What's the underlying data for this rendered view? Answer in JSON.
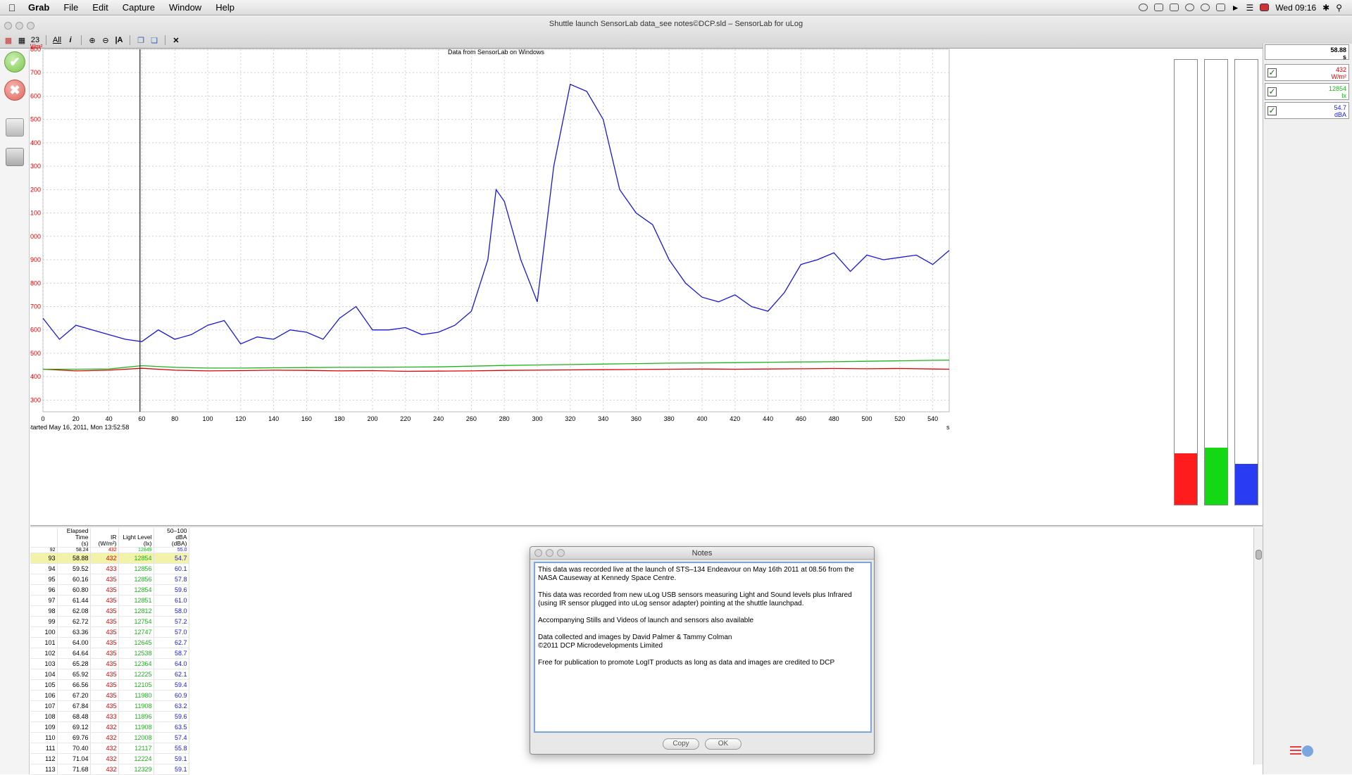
{
  "menubar": {
    "app": "Grab",
    "items": [
      "File",
      "Edit",
      "Capture",
      "Window",
      "Help"
    ],
    "clock": "Wed 09:16"
  },
  "window": {
    "title": "Shuttle launch SensorLab data_see notes©DCP.sld – SensorLab for uLog"
  },
  "toolbar": {
    "all_label": "All",
    "count_label": "23"
  },
  "colors": {
    "ir": "#e00000",
    "light": "#1bb51b",
    "sound": "#1818d8",
    "selected_row": "#f2f2a8"
  },
  "chart_data": {
    "type": "line",
    "title": "Data from SensorLab on Windows",
    "ylabel": "W/m²",
    "xunit": "s",
    "started": "Started May 16, 2011, Mon 13:52:58",
    "xlim": [
      0,
      550
    ],
    "ylim": [
      250,
      1800
    ],
    "xticks": [
      0,
      20,
      40,
      60,
      80,
      100,
      120,
      140,
      160,
      180,
      200,
      220,
      240,
      260,
      280,
      300,
      320,
      340,
      360,
      380,
      400,
      420,
      440,
      460,
      480,
      500,
      520,
      540
    ],
    "yticks": [
      300,
      400,
      500,
      600,
      700,
      800,
      900,
      1000,
      1100,
      1200,
      1300,
      1400,
      1500,
      1600,
      1700,
      1800
    ],
    "cursor_x": 58.88,
    "grid": true,
    "series": [
      {
        "name": "IR",
        "color": "#e00000",
        "x": [
          0,
          20,
          40,
          60,
          80,
          100,
          120,
          140,
          160,
          180,
          200,
          220,
          240,
          260,
          280,
          300,
          320,
          340,
          360,
          380,
          400,
          420,
          440,
          460,
          480,
          500,
          520,
          540,
          550
        ],
        "values": [
          432,
          425,
          428,
          436,
          428,
          425,
          426,
          428,
          427,
          425,
          426,
          423,
          424,
          425,
          427,
          428,
          429,
          430,
          431,
          432,
          433,
          432,
          433,
          434,
          435,
          434,
          435,
          433,
          432
        ]
      },
      {
        "name": "Light Level",
        "color": "#1bb51b",
        "x": [
          0,
          20,
          40,
          60,
          80,
          100,
          120,
          140,
          160,
          180,
          200,
          220,
          240,
          260,
          280,
          300,
          320,
          340,
          360,
          380,
          400,
          420,
          440,
          460,
          480,
          500,
          520,
          540,
          550
        ],
        "values": [
          432,
          432,
          433,
          447,
          440,
          437,
          437,
          438,
          439,
          440,
          440,
          441,
          442,
          445,
          448,
          450,
          452,
          454,
          456,
          458,
          459,
          460,
          462,
          463,
          464,
          466,
          468,
          470,
          471
        ]
      },
      {
        "name": "50-100 dBA",
        "color": "#1818d8",
        "x": [
          0,
          10,
          20,
          30,
          40,
          50,
          60,
          70,
          80,
          90,
          100,
          110,
          120,
          130,
          140,
          150,
          160,
          170,
          180,
          190,
          200,
          210,
          220,
          230,
          240,
          250,
          260,
          270,
          275,
          280,
          290,
          300,
          310,
          320,
          330,
          340,
          350,
          360,
          370,
          380,
          390,
          400,
          410,
          420,
          430,
          440,
          450,
          460,
          470,
          480,
          490,
          500,
          510,
          520,
          530,
          540,
          550
        ],
        "values": [
          650,
          560,
          620,
          600,
          580,
          560,
          550,
          600,
          560,
          580,
          620,
          640,
          540,
          570,
          560,
          600,
          590,
          560,
          650,
          700,
          600,
          600,
          610,
          580,
          590,
          620,
          680,
          900,
          1200,
          1150,
          900,
          720,
          1300,
          1650,
          1620,
          1500,
          1200,
          1100,
          1050,
          900,
          800,
          740,
          720,
          750,
          700,
          680,
          760,
          880,
          900,
          930,
          850,
          920,
          900,
          910,
          920,
          880,
          940
        ]
      }
    ]
  },
  "levelbars": {
    "ir_level": 0.115,
    "light_level": 0.128,
    "sound_level": 0.092
  },
  "readouts": {
    "time": {
      "value": "58.88",
      "unit": "s"
    },
    "ir": {
      "value": "432",
      "unit": "W/m²"
    },
    "light": {
      "value": "12854",
      "unit": "lx"
    },
    "sound": {
      "value": "54.7",
      "unit": "dBA"
    }
  },
  "table": {
    "headers": [
      {
        "l1": "",
        "l2": ""
      },
      {
        "l1": "Elapsed Time",
        "l2": "(s)"
      },
      {
        "l1": "IR",
        "l2": "(W/m²)"
      },
      {
        "l1": "Light Level",
        "l2": "(lx)"
      },
      {
        "l1": "50–100 dBA",
        "l2": "(dBA)"
      }
    ],
    "partial_row": [
      "92",
      "58.24",
      "432",
      "12849",
      "55.0"
    ],
    "rows": [
      [
        "93",
        "58.88",
        "432",
        "12854",
        "54.7"
      ],
      [
        "94",
        "59.52",
        "433",
        "12856",
        "60.1"
      ],
      [
        "95",
        "60.16",
        "435",
        "12856",
        "57.8"
      ],
      [
        "96",
        "60.80",
        "435",
        "12854",
        "59.6"
      ],
      [
        "97",
        "61.44",
        "435",
        "12851",
        "61.0"
      ],
      [
        "98",
        "62.08",
        "435",
        "12812",
        "58.0"
      ],
      [
        "99",
        "62.72",
        "435",
        "12754",
        "57.2"
      ],
      [
        "100",
        "63.36",
        "435",
        "12747",
        "57.0"
      ],
      [
        "101",
        "64.00",
        "435",
        "12645",
        "62.7"
      ],
      [
        "102",
        "64.64",
        "435",
        "12538",
        "58.7"
      ],
      [
        "103",
        "65.28",
        "435",
        "12364",
        "64.0"
      ],
      [
        "104",
        "65.92",
        "435",
        "12225",
        "62.1"
      ],
      [
        "105",
        "66.56",
        "435",
        "12105",
        "59.4"
      ],
      [
        "106",
        "67.20",
        "435",
        "11980",
        "60.9"
      ],
      [
        "107",
        "67.84",
        "435",
        "11908",
        "63.2"
      ],
      [
        "108",
        "68.48",
        "433",
        "11896",
        "59.6"
      ],
      [
        "109",
        "69.12",
        "432",
        "11908",
        "63.5"
      ],
      [
        "110",
        "69.76",
        "432",
        "12008",
        "57.4"
      ],
      [
        "111",
        "70.40",
        "432",
        "12117",
        "55.8"
      ],
      [
        "112",
        "71.04",
        "432",
        "12224",
        "59.1"
      ],
      [
        "113",
        "71.68",
        "432",
        "12329",
        "59.1"
      ]
    ],
    "selected_index": 0
  },
  "notes": {
    "title": "Notes",
    "paragraphs": [
      "This data was recorded live at the launch of STS–134 Endeavour on May 16th 2011 at 08.56 from the NASA Causeway at Kennedy Space Centre.",
      "This data was recorded from new uLog USB sensors measuring Light and Sound levels plus Infrared (using IR sensor plugged into uLog sensor adapter) pointing at the shuttle launchpad.",
      "Accompanying Stills and Videos of launch and sensors also available",
      "Data collected and images by David Palmer & Tammy Colman\n©2011 DCP Microdevelopments Limited",
      "Free for publication to promote LogIT products as long as data and images are credited to DCP"
    ],
    "copy_label": "Copy",
    "ok_label": "OK"
  }
}
